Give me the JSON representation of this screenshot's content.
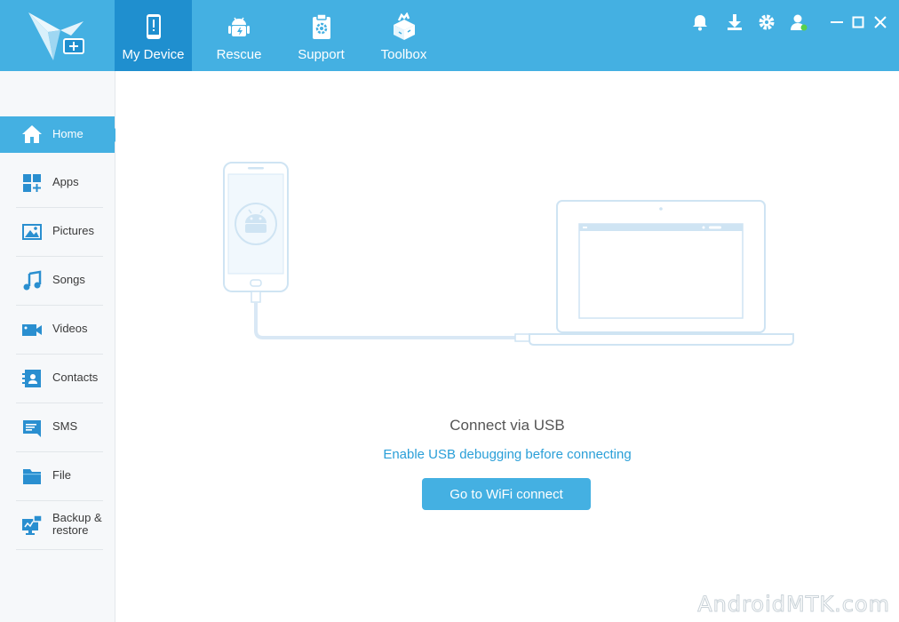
{
  "app": {
    "nav": [
      {
        "label": "My Device",
        "icon": "phone-alert-icon",
        "active": true
      },
      {
        "label": "Rescue",
        "icon": "android-icon"
      },
      {
        "label": "Support",
        "icon": "clipboard-gear-icon"
      },
      {
        "label": "Toolbox",
        "icon": "toolbox-icon"
      }
    ],
    "toolbar_icons": [
      "bell-icon",
      "download-icon",
      "gear-icon",
      "user-icon",
      "minimize-icon",
      "maximize-icon",
      "close-icon"
    ]
  },
  "sidebar": {
    "items": [
      {
        "label": "Home",
        "icon": "home-icon",
        "active": true
      },
      {
        "label": "Apps",
        "icon": "apps-grid-icon"
      },
      {
        "label": "Pictures",
        "icon": "picture-icon"
      },
      {
        "label": "Songs",
        "icon": "music-note-icon"
      },
      {
        "label": "Videos",
        "icon": "video-camera-icon"
      },
      {
        "label": "Contacts",
        "icon": "contact-card-icon"
      },
      {
        "label": "SMS",
        "icon": "message-icon"
      },
      {
        "label": "File",
        "icon": "folder-icon"
      },
      {
        "label_line1": "Backup &",
        "label_line2": "restore",
        "icon": "backup-monitor-icon"
      }
    ]
  },
  "main": {
    "title": "Connect via USB",
    "subtitle": "Enable USB debugging before connecting",
    "wifi_button": "Go to WiFi connect"
  },
  "watermark": "AndroidMTK.com",
  "colors": {
    "accent": "#44b0e2",
    "accent_dark": "#1f8fcf",
    "link": "#2a9fd8",
    "status_online": "#57d04a"
  }
}
